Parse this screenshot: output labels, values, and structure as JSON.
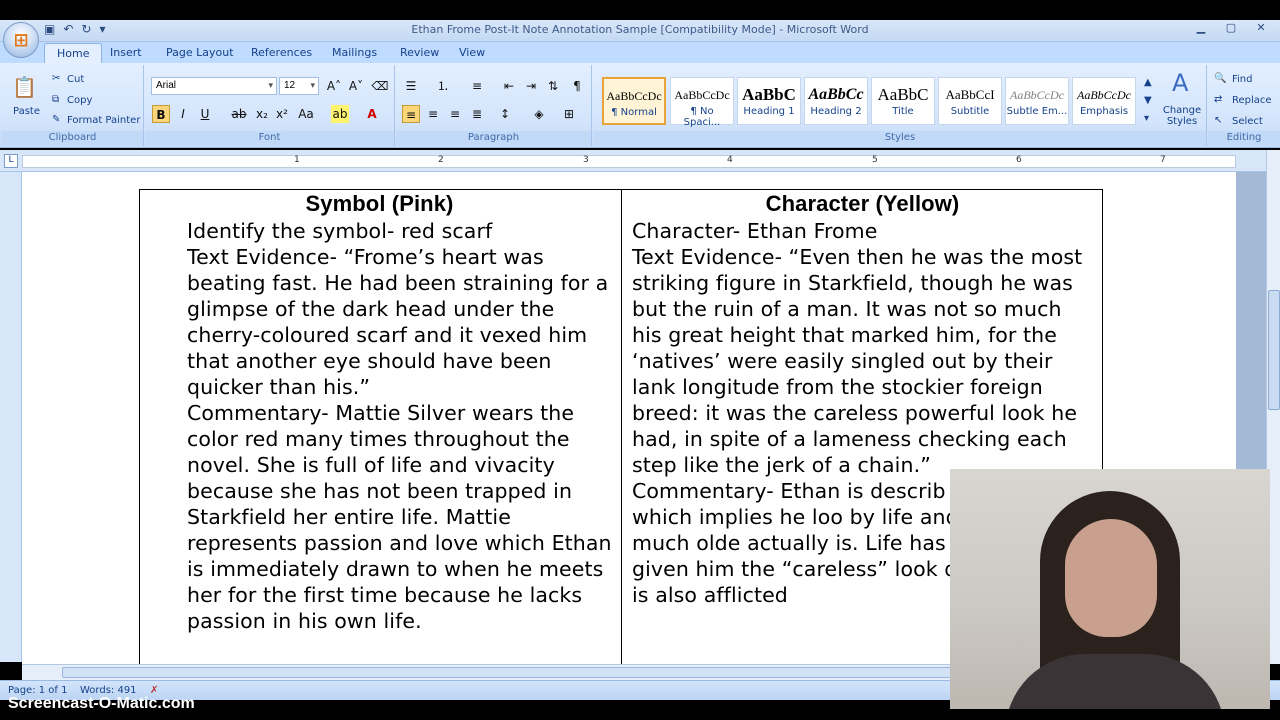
{
  "window": {
    "title": "Ethan Frome Post-It Note Annotation Sample [Compatibility Mode] - Microsoft Word"
  },
  "ribbon_tabs": [
    "Home",
    "Insert",
    "Page Layout",
    "References",
    "Mailings",
    "Review",
    "View"
  ],
  "clipboard": {
    "paste": "Paste",
    "cut": "Cut",
    "copy": "Copy",
    "format_painter": "Format Painter",
    "label": "Clipboard"
  },
  "font": {
    "name": "Arial",
    "size": "12",
    "label": "Font"
  },
  "paragraph": {
    "label": "Paragraph"
  },
  "styles": {
    "label": "Styles",
    "items": [
      {
        "sample": "AaBbCcDc",
        "name": "¶ Normal"
      },
      {
        "sample": "AaBbCcDc",
        "name": "¶ No Spaci..."
      },
      {
        "sample": "AaBbC",
        "name": "Heading 1"
      },
      {
        "sample": "AaBbCc",
        "name": "Heading 2"
      },
      {
        "sample": "AaBbC",
        "name": "Title"
      },
      {
        "sample": "AaBbCcI",
        "name": "Subtitle"
      },
      {
        "sample": "AaBbCcDc",
        "name": "Subtle Em..."
      },
      {
        "sample": "AaBbCcDc",
        "name": "Emphasis"
      }
    ],
    "change_styles": "Change Styles"
  },
  "editing": {
    "label": "Editing",
    "find": "Find",
    "replace": "Replace",
    "select": "Select"
  },
  "ruler_numbers": [
    "1",
    "2",
    "3",
    "4",
    "5",
    "6",
    "7"
  ],
  "document": {
    "left": {
      "heading": "Symbol (Pink)",
      "line1": "Identify the symbol- red scarf",
      "evidence_label": "Text Evidence",
      "evidence_text": "- “Frome’s heart was beating fast.  He had been straining for a glimpse of the dark head under the cherry-coloured scarf and it vexed him that another eye should have been quicker than his.”",
      "commentary_label": "Commentary",
      "commentary_text": "- Mattie Silver wears  the color red many times throughout the novel.  She is full of life and vivacity because she has not been trapped in Starkfield her entire life.  Mattie represents passion and love which Ethan is immediately drawn to when he meets her for the first time because he lacks passion in his own life."
    },
    "right": {
      "heading": "Character (Yellow)",
      "line1": "Character- Ethan Frome",
      "evidence_label": "Text Evidence",
      "evidence_text": "- “Even then he was the most striking figure in Starkfield, though he was but the ruin of a man.  It was not so much his great height that marked him, for the ‘natives’ were easily singled out by their lank longitude from the stockier foreign breed: it was the careless powerful look he had, in spite of a lameness checking each step like the jerk of a chain.”",
      "commentary_label": "Commentary",
      "commentary_text": "- Ethan is describ “ruined”, which implies he loo by life and appears much olde actually is.  Life has worn him given him the “careless” look describes.  He is also afflicted"
    }
  },
  "status": {
    "page": "Page: 1 of 1",
    "words": "Words: 491"
  },
  "watermark": "Screencast-O-Matic.com"
}
